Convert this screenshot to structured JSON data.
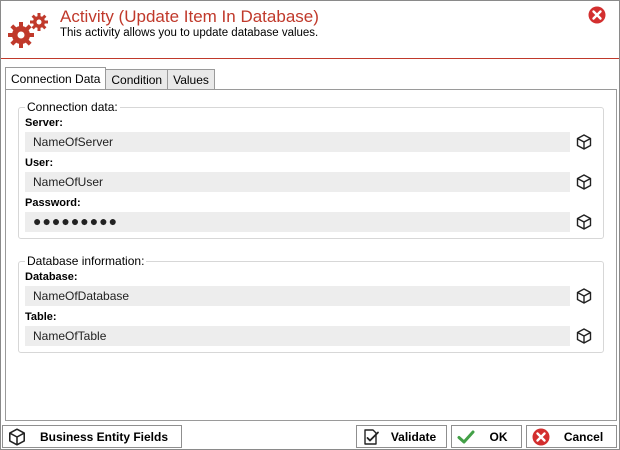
{
  "header": {
    "title": "Activity (Update Item In Database)",
    "subtitle": "This activity allows you to update database values."
  },
  "tabs": [
    {
      "label": "Connection Data",
      "active": true
    },
    {
      "label": "Condition",
      "active": false
    },
    {
      "label": "Values",
      "active": false
    }
  ],
  "connection": {
    "legend": "Connection data:",
    "server_label": "Server:",
    "server_value": "NameOfServer",
    "user_label": "User:",
    "user_value": "NameOfUser",
    "password_label": "Password:",
    "password_value": "●●●●●●●●●"
  },
  "database": {
    "legend": "Database information:",
    "database_label": "Database:",
    "database_value": "NameOfDatabase",
    "table_label": "Table:",
    "table_value": "NameOfTable"
  },
  "footer": {
    "business_label": "Business Entity Fields",
    "validate_label": "Validate",
    "ok_label": "OK",
    "cancel_label": "Cancel"
  },
  "colors": {
    "accent": "#c0392b",
    "close": "#d32f2f",
    "ok_check": "#43a047"
  }
}
